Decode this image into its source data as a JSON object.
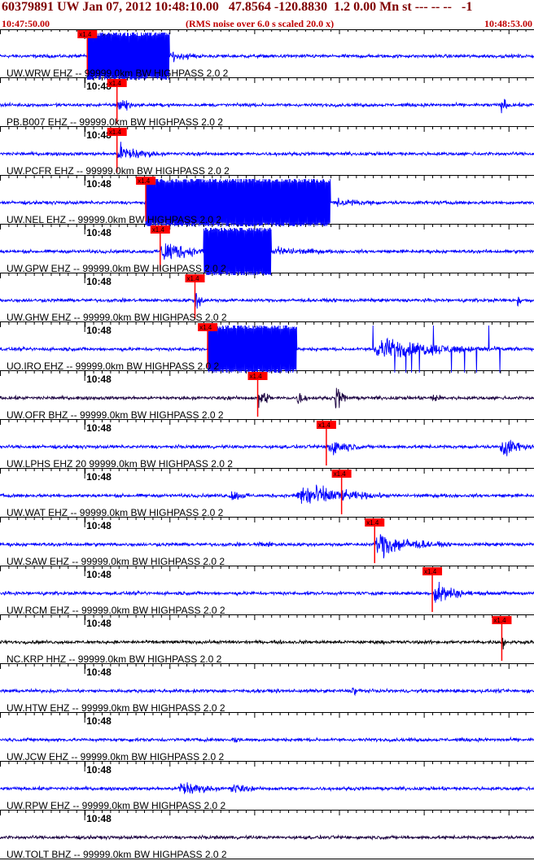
{
  "header": {
    "title": "60379891 UW Jan 07, 2012 10:48:10.00   47.8564 -120.8830  1.2 0.00 Mn st --- -- --   -1",
    "start_time": "10:47:50.00",
    "note": "(RMS noise over 6.0 s scaled 20.0 x)",
    "end_time": "10:48:53.00"
  },
  "colors": {
    "trace": "#0000ff",
    "trace_dark": "#1a0040",
    "trace_black": "#000000",
    "pick": "#ff0000",
    "text_header": "#800000",
    "grid": "#000000"
  },
  "chart_data": {
    "type": "seismogram",
    "x_range_seconds": [
      0,
      63
    ],
    "minute_tick_label": "10:48",
    "minute_tick_second": 10,
    "pick_label": "x1.4",
    "traces": [
      {
        "station": "UW.WRW EHZ -- 99999.0km BW  HIGHPASS  2.0  2",
        "pick_s": 10.3,
        "color": "trace",
        "events": [
          {
            "start": 10.3,
            "end": 20.0,
            "amp": 1.0,
            "clip": true
          },
          {
            "start": 20.0,
            "end": 26.0,
            "amp": 0.4
          }
        ]
      },
      {
        "station": "PB.B007 EHZ -- 99999.0km BW  HIGHPASS  2.0  2",
        "pick_s": 13.8,
        "color": "trace",
        "events": [
          {
            "start": 13.8,
            "end": 16.0,
            "amp": 1.0
          },
          {
            "start": 59.0,
            "end": 61.0,
            "amp": 0.6
          }
        ]
      },
      {
        "station": "UW.PCFR EHZ -- 99999.0km BW  HIGHPASS  2.0  2",
        "pick_s": 13.8,
        "color": "trace",
        "events": [
          {
            "start": 13.8,
            "end": 20.0,
            "amp": 0.75
          }
        ]
      },
      {
        "station": "UW.NEL EHZ -- 99999.0km BW  HIGHPASS  2.0  2",
        "pick_s": 17.2,
        "color": "trace",
        "events": [
          {
            "start": 17.2,
            "end": 39.0,
            "amp": 1.0,
            "clip": true
          },
          {
            "start": 39.0,
            "end": 52.0,
            "amp": 0.3
          }
        ]
      },
      {
        "station": "UW.GPW EHZ -- 99999.0km BW  HIGHPASS  2.0  2",
        "pick_s": 18.9,
        "color": "trace",
        "events": [
          {
            "start": 18.9,
            "end": 26.0,
            "amp": 0.9
          },
          {
            "start": 24.0,
            "end": 32.0,
            "amp": 1.0,
            "clip": true
          },
          {
            "start": 32.0,
            "end": 45.0,
            "amp": 0.35
          }
        ]
      },
      {
        "station": "UW.GHW EHZ -- 99999.0km BW  HIGHPASS  2.0  2",
        "pick_s": 23.0,
        "color": "trace",
        "events": [
          {
            "start": 23.0,
            "end": 24.5,
            "amp": 0.9
          },
          {
            "start": 61.0,
            "end": 62.0,
            "amp": 0.6
          }
        ]
      },
      {
        "station": "UO.IRO EHZ -- 99999.0km BW  HIGHPASS  2.0  2",
        "pick_s": 24.5,
        "color": "trace",
        "events": [
          {
            "start": 24.5,
            "end": 35.0,
            "amp": 1.0,
            "clip": true
          },
          {
            "start": 44.0,
            "end": 62.0,
            "amp": 0.8,
            "spiky": true
          }
        ]
      },
      {
        "station": "UW.OFR BHZ -- 99999.0km BW  HIGHPASS  2.0  2",
        "pick_s": 30.4,
        "color": "trace_dark",
        "events": [
          {
            "start": 30.4,
            "end": 32.5,
            "amp": 0.9
          },
          {
            "start": 35.0,
            "end": 37.0,
            "amp": 0.6
          },
          {
            "start": 39.5,
            "end": 41.5,
            "amp": 1.0
          },
          {
            "start": 51.0,
            "end": 53.0,
            "amp": 0.45
          }
        ]
      },
      {
        "station": "UW.LPHS EHZ 20 99999.0km BW  HIGHPASS  2.0  2",
        "pick_s": 38.5,
        "color": "trace",
        "events": [
          {
            "start": 38.5,
            "end": 44.0,
            "amp": 0.7
          },
          {
            "start": 59.0,
            "end": 63.0,
            "amp": 0.9
          }
        ]
      },
      {
        "station": "UW.WAT EHZ -- 99999.0km BW  HIGHPASS  2.0  2",
        "pick_s": 40.3,
        "color": "trace",
        "events": [
          {
            "start": 27.0,
            "end": 31.0,
            "amp": 0.45
          },
          {
            "start": 35.0,
            "end": 46.0,
            "amp": 1.0
          }
        ]
      },
      {
        "station": "UW.SAW EHZ -- 99999.0km BW  HIGHPASS  2.0  2",
        "pick_s": 44.2,
        "color": "trace",
        "events": [
          {
            "start": 44.2,
            "end": 53.0,
            "amp": 1.0
          },
          {
            "start": 30.0,
            "end": 38.0,
            "amp": 0.25
          }
        ]
      },
      {
        "station": "UW.RCM EHZ -- 99999.0km BW  HIGHPASS  2.0  2",
        "pick_s": 51.0,
        "color": "trace",
        "events": [
          {
            "start": 51.0,
            "end": 56.0,
            "amp": 1.0
          }
        ]
      },
      {
        "station": "NC.KRP HHZ -- 99999.0km BW  HIGHPASS  2.0  2",
        "pick_s": 59.2,
        "color": "trace_black",
        "events": [
          {
            "start": 59.2,
            "end": 60.0,
            "amp": 0.8
          }
        ]
      },
      {
        "station": "UW.HTW EHZ -- 99999.0km BW  HIGHPASS  2.0  2",
        "pick_s": null,
        "color": "trace",
        "events": [
          {
            "start": 41.5,
            "end": 43.5,
            "amp": 0.5
          }
        ]
      },
      {
        "station": "UW.JCW EHZ -- 99999.0km BW  HIGHPASS  2.0  2",
        "pick_s": null,
        "color": "trace",
        "events": [
          {
            "start": 27.5,
            "end": 30.0,
            "amp": 0.3
          }
        ]
      },
      {
        "station": "UW.RPW EHZ -- 99999.0km BW  HIGHPASS  2.0  2",
        "pick_s": null,
        "color": "trace",
        "events": [
          {
            "start": 21.0,
            "end": 27.0,
            "amp": 0.7
          },
          {
            "start": 27.0,
            "end": 32.0,
            "amp": 0.45
          }
        ]
      },
      {
        "station": "UW.TOLT BHZ -- 99999.0km BW  HIGHPASS  2.0  2",
        "pick_s": null,
        "color": "trace_dark",
        "events": []
      }
    ]
  }
}
